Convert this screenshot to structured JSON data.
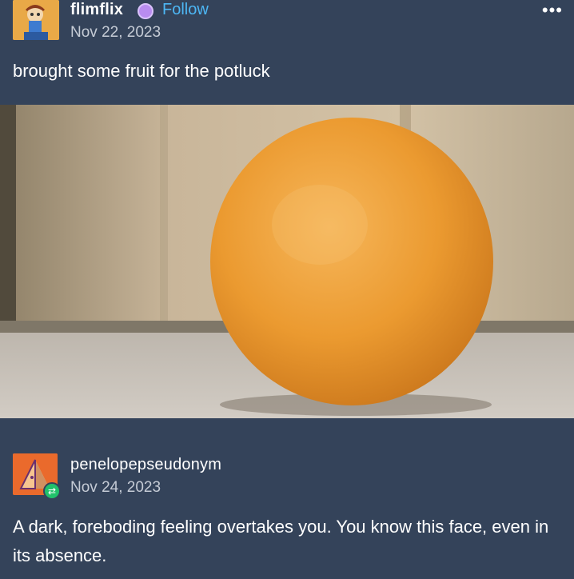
{
  "original_post": {
    "username": "flimflix",
    "follow_label": "Follow",
    "date": "Nov 22, 2023",
    "more_label": "•••",
    "caption": "brought some fruit for the potluck",
    "image_icon": "orange-photo"
  },
  "reply_post": {
    "username": "penelopepseudonym",
    "date": "Nov 24, 2023",
    "reblog_icon": "reblog-icon",
    "text": "A dark, foreboding feeling overtakes you. You know this face, even in its absence."
  },
  "colors": {
    "background": "#34435a",
    "follow_link": "#4db7f5",
    "orange": "#f0a43a"
  }
}
